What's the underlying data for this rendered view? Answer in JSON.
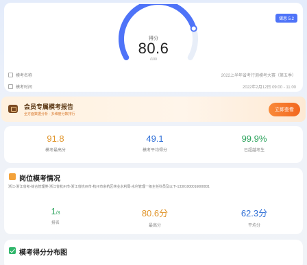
{
  "score": {
    "version": "储思 5.2",
    "label": "得分",
    "value": "80.6",
    "total": "/100",
    "fraction": 0.806,
    "gauge_track_color": "#e8eef8",
    "gauge_fill_color": "#4e73f8"
  },
  "exam_info": [
    {
      "label": "模考名称",
      "value": "2022上半年省考行测模考大赛（第五季）"
    },
    {
      "label": "模考时间",
      "value": "2022年2月12日 09:00 - 11:00"
    }
  ],
  "vip": {
    "title": "会员专属模考报告",
    "subtitle": "全方面数据分析 · 多维度分数排行",
    "button": "立即查看"
  },
  "stats": [
    {
      "value": "91.8",
      "label": "模考最高分",
      "color": "#e0952b"
    },
    {
      "value": "49.1",
      "label": "模考平均得分",
      "color": "#2f6fd6"
    },
    {
      "value": "99.9%",
      "label": "已超越考生",
      "color": "#2ca35c"
    }
  ],
  "position": {
    "title": "岗位模考情况",
    "path": "浙江-浙江省考-综合管理类-浙江省杭州市-浙江省杭州市-杭州市余杭区林业水利局-水利管理一级主任科员及以下-13301000016000001",
    "stats": [
      {
        "value": "1",
        "suffix": "/3",
        "label": "排名",
        "color": "#2ca35c"
      },
      {
        "value": "80.6",
        "suffix": "分",
        "label": "最高分",
        "color": "#e0952b"
      },
      {
        "value": "62.3",
        "suffix": "分",
        "label": "平均分",
        "color": "#2f6fd6"
      }
    ]
  },
  "distribution": {
    "title": "模考得分分布图"
  }
}
